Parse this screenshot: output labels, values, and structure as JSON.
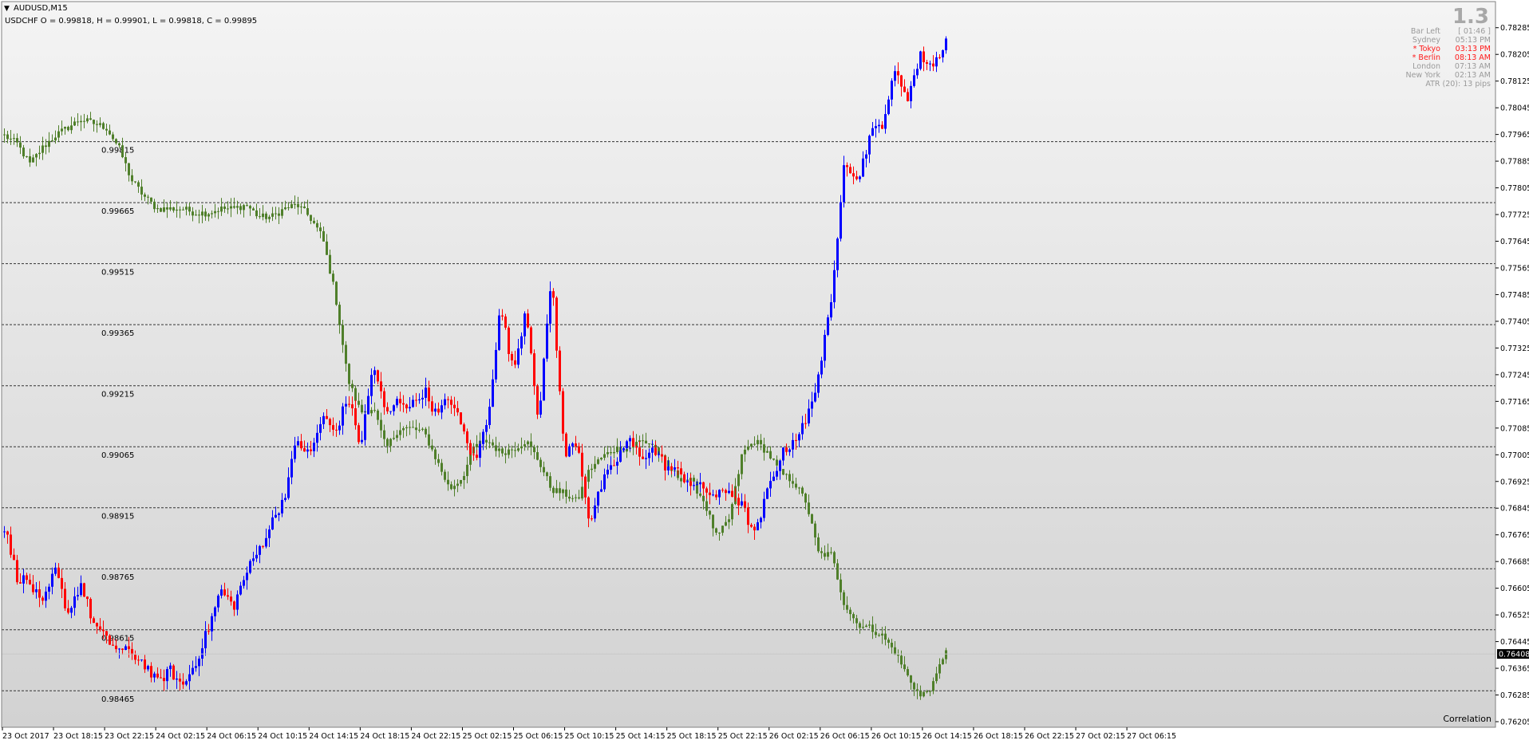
{
  "window": {
    "title": "AUDUSD,M15",
    "overlay": "USDCHF O = 0.99818, H = 0.99901, L = 0.99818, C = 0.99895"
  },
  "info_panel": {
    "big_value": "1.3",
    "rows": [
      {
        "label": "Bar Left",
        "value": "[ 01:46 ]",
        "color": "gray"
      },
      {
        "label": "Sydney",
        "value": "05:13 PM",
        "color": "gray"
      },
      {
        "label": "* Tokyo",
        "value": "03:13 PM",
        "color": "red"
      },
      {
        "label": "* Berlin",
        "value": "08:13 AM",
        "color": "red"
      },
      {
        "label": "London",
        "value": "07:13 AM",
        "color": "gray"
      },
      {
        "label": "New York",
        "value": "02:13 AM",
        "color": "gray"
      }
    ],
    "atr": "ATR (20): 13 pips"
  },
  "correlation_label": "Correlation",
  "current_price": "0.76408",
  "colors": {
    "up": "#0000ff",
    "down": "#ff0000",
    "overlay": "#4f7f2a",
    "level_line": "#333333",
    "background_top": "#f4f4f4",
    "background_bottom": "#d2d2d2"
  },
  "chart_data": {
    "type": "candlestick",
    "series": [
      {
        "name": "AUDUSD,M15",
        "axis": "right",
        "ylim": [
          0.76205,
          0.78325
        ]
      },
      {
        "name": "USDCHF",
        "axis": "levels",
        "ylim": [
          0.98389,
          1.00128
        ]
      }
    ],
    "price_axis": [
      "0.78285",
      "0.78205",
      "0.78125",
      "0.78045",
      "0.77965",
      "0.77885",
      "0.77805",
      "0.77725",
      "0.77645",
      "0.77565",
      "0.77485",
      "0.77405",
      "0.77325",
      "0.77245",
      "0.77165",
      "0.77085",
      "0.77005",
      "0.76925",
      "0.76845",
      "0.76765",
      "0.76685",
      "0.76605",
      "0.76525",
      "0.76445",
      "0.76365",
      "0.76285",
      "0.76205"
    ],
    "time_axis": [
      "23 Oct 2017",
      "23 Oct 18:15",
      "23 Oct 22:15",
      "24 Oct 02:15",
      "24 Oct 06:15",
      "24 Oct 10:15",
      "24 Oct 14:15",
      "24 Oct 18:15",
      "24 Oct 22:15",
      "25 Oct 02:15",
      "25 Oct 06:15",
      "25 Oct 10:15",
      "25 Oct 14:15",
      "25 Oct 18:15",
      "25 Oct 22:15",
      "26 Oct 02:15",
      "26 Oct 06:15",
      "26 Oct 10:15",
      "26 Oct 14:15",
      "26 Oct 18:15",
      "26 Oct 22:15",
      "27 Oct 02:15",
      "27 Oct 06:15"
    ],
    "levels": [
      "0.99815",
      "0.99665",
      "0.99515",
      "0.99365",
      "0.99215",
      "0.99065",
      "0.98915",
      "0.98765",
      "0.98615",
      "0.98465"
    ],
    "audusd_close_path": [
      0.7679,
      0.7664,
      0.7662,
      0.7655,
      0.7666,
      0.7653,
      0.7662,
      0.765,
      0.7645,
      0.7642,
      0.7641,
      0.7638,
      0.7632,
      0.7636,
      0.7631,
      0.7638,
      0.7648,
      0.766,
      0.7655,
      0.7665,
      0.7672,
      0.768,
      0.7688,
      0.7705,
      0.77,
      0.7712,
      0.7707,
      0.7718,
      0.7703,
      0.7728,
      0.7712,
      0.7717,
      0.7715,
      0.772,
      0.7712,
      0.7718,
      0.7708,
      0.7698,
      0.7712,
      0.7745,
      0.7725,
      0.7745,
      0.771,
      0.7755,
      0.77,
      0.7705,
      0.768,
      0.7692,
      0.7698,
      0.7705,
      0.77,
      0.7702,
      0.7697,
      0.7695,
      0.7692,
      0.769,
      0.7688,
      0.769,
      0.7685,
      0.7676,
      0.769,
      0.77,
      0.7705,
      0.771,
      0.7725,
      0.7746,
      0.779,
      0.7782,
      0.7796,
      0.78,
      0.7815,
      0.7808,
      0.782,
      0.7817,
      0.7825
    ],
    "usdchf_close_path": [
      0.9983,
      0.9981,
      0.9976,
      0.998,
      0.9983,
      0.9985,
      0.9987,
      0.9986,
      0.9985,
      0.998,
      0.9972,
      0.9968,
      0.9965,
      0.9965,
      0.9965,
      0.9964,
      0.9964,
      0.9965,
      0.9965,
      0.9966,
      0.9963,
      0.9963,
      0.9965,
      0.9966,
      0.9963,
      0.9958,
      0.9944,
      0.9923,
      0.9915,
      0.9916,
      0.9906,
      0.9911,
      0.9911,
      0.991,
      0.9903,
      0.9896,
      0.9899,
      0.9907,
      0.9908,
      0.9905,
      0.9906,
      0.9908,
      0.9903,
      0.9896,
      0.9895,
      0.9893,
      0.9901,
      0.9904,
      0.9906,
      0.9906,
      0.9908,
      0.9907,
      0.9902,
      0.9899,
      0.9898,
      0.9893,
      0.9884,
      0.9889,
      0.9905,
      0.9908,
      0.9905,
      0.99,
      0.9898,
      0.9893,
      0.988,
      0.988,
      0.9868,
      0.9863,
      0.9862,
      0.986,
      0.9856,
      0.985,
      0.9845,
      0.9848,
      0.9857
    ]
  }
}
